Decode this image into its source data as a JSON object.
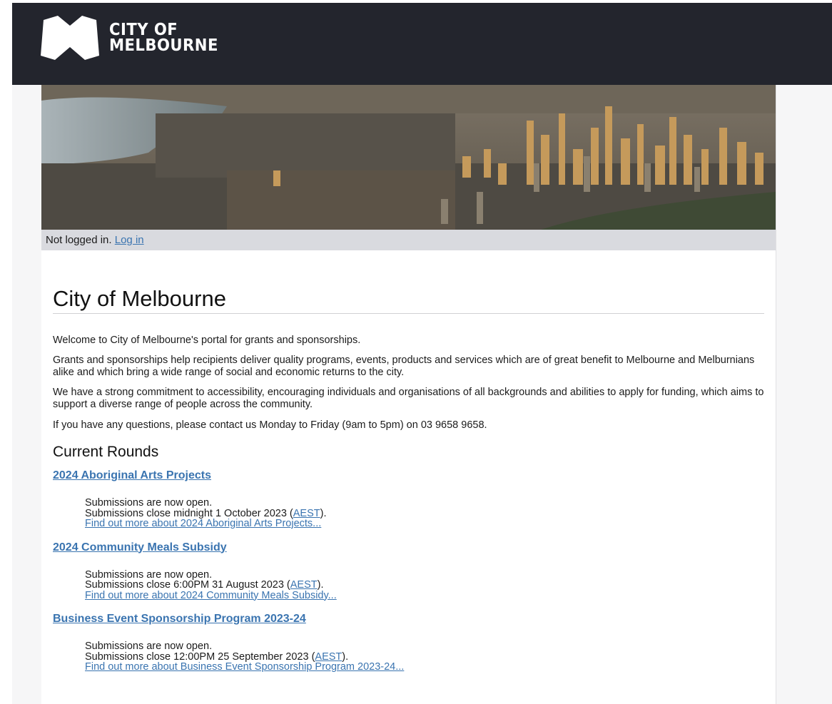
{
  "header": {
    "logo_line1": "CITY OF",
    "logo_line2": "MELBOURNE",
    "logo_icon": "city-of-melbourne-m-logo"
  },
  "hero": {
    "image": "aerial-melbourne-city-skyline"
  },
  "status": {
    "text": "Not logged in.",
    "login_label": "Log in"
  },
  "page": {
    "title": "City of Melbourne",
    "intro": [
      "Welcome to City of Melbourne's portal for grants and sponsorships.",
      "Grants and sponsorships help recipients deliver quality programs, events, products and services which are of great benefit to Melbourne and Melburnians alike and which bring a wide range of social and economic returns to the city.",
      "We have a strong commitment to accessibility, encouraging individuals and organisations of all backgrounds and abilities to apply for funding, which aims to support a diverse range of people across the community.",
      "If you have any questions, please contact us Monday to Friday (9am to 5pm) on 03 9658 9658."
    ],
    "rounds_heading": "Current Rounds"
  },
  "rounds": [
    {
      "title": "2024 Aboriginal Arts Projects",
      "status": "Submissions are now open.",
      "close_prefix": "Submissions close midnight 1 October 2023 (",
      "tz": "AEST",
      "close_suffix": ").",
      "more": "Find out more about 2024 Aboriginal Arts Projects..."
    },
    {
      "title": "2024 Community Meals Subsidy",
      "status": "Submissions are now open.",
      "close_prefix": "Submissions close 6:00PM 31 August 2023 (",
      "tz": "AEST",
      "close_suffix": ").",
      "more": "Find out more about 2024 Community Meals Subsidy..."
    },
    {
      "title": "Business Event Sponsorship Program 2023-24",
      "status": "Submissions are now open.",
      "close_prefix": "Submissions close 12:00PM 25 September 2023 (",
      "tz": "AEST",
      "close_suffix": ").",
      "more": "Find out more about Business Event Sponsorship Program 2023-24..."
    }
  ],
  "colors": {
    "header_bg": "#23252d",
    "link": "#3a74b0",
    "status_bg": "#d9dadf"
  }
}
